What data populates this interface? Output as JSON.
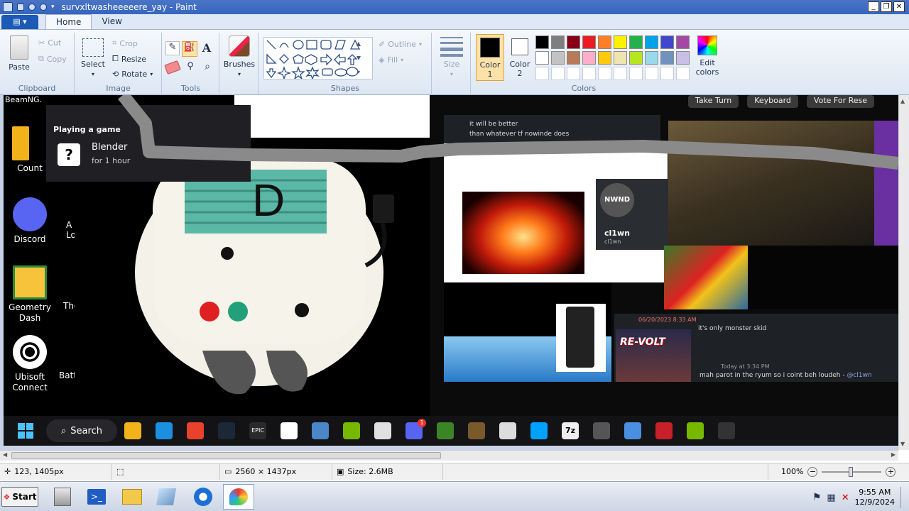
{
  "window": {
    "title": "survxltwasheeeeere_yay - Paint",
    "min": "_",
    "max": "❐",
    "close": "✕"
  },
  "ribbon_tabs": [
    {
      "label": "Home",
      "active": true
    },
    {
      "label": "View",
      "active": false
    }
  ],
  "clipboard": {
    "group": "Clipboard",
    "paste": "Paste",
    "cut": "Cut",
    "copy": "Copy"
  },
  "image": {
    "group": "Image",
    "select": "Select",
    "crop": "Crop",
    "resize": "Resize",
    "rotate": "Rotate"
  },
  "tools": {
    "group": "Tools",
    "pencil": "pencil-icon",
    "fill": "fill-bucket-icon",
    "text": "A",
    "eraser": "eraser-icon",
    "picker": "color-picker-icon",
    "magnifier": "magnifier-icon"
  },
  "brushes": {
    "label": "Brushes"
  },
  "shapes": {
    "group": "Shapes",
    "outline": "Outline",
    "fill": "Fill",
    "size": "Size"
  },
  "colors": {
    "group": "Colors",
    "color1_label": "Color",
    "color1_num": "1",
    "color2_label": "Color",
    "color2_num": "2",
    "edit_label1": "Edit",
    "edit_label2": "colors",
    "color1": "#000000",
    "color2": "#ffffff",
    "palette_row1": [
      "#000000",
      "#7f7f7f",
      "#880015",
      "#ed1c24",
      "#ff7f27",
      "#fff200",
      "#22b14c",
      "#00a2e8",
      "#3f48cc",
      "#a349a4"
    ],
    "palette_row2": [
      "#ffffff",
      "#c3c3c3",
      "#b97a57",
      "#ffaec9",
      "#ffc90e",
      "#efe4b0",
      "#b5e61d",
      "#99d9ea",
      "#7092be",
      "#c8bfe7"
    ]
  },
  "status": {
    "position": "123, 1405px",
    "dimensions": "2560 × 1437px",
    "size": "Size: 2.6MB",
    "zoom": "100%"
  },
  "taskbar": {
    "start": "Start",
    "time": "9:55 AM",
    "date": "12/9/2024"
  },
  "screenshot": {
    "desktop_icons": [
      {
        "label": "Count",
        "color": "#f2b21a"
      },
      {
        "label": "Discord",
        "color": "#5865f2"
      },
      {
        "label": "Geometry Dash",
        "color": "#f6c33a"
      },
      {
        "label": "Ubisoft Connect",
        "color": "#ffffff"
      }
    ],
    "desktop_icons_col2": [
      "A Lo",
      "Tho",
      "Battl"
    ],
    "beamng_label": "BeamNG.",
    "popup_header": "Playing a game",
    "popup_game": "Blender",
    "popup_time": "for 1 hour",
    "plush_letter": "D",
    "top_buttons": [
      "Take Turn",
      "Keyboard",
      "Vote For Rese"
    ],
    "chat_top": [
      "it will be better",
      "than whatever tf nowinde does"
    ],
    "nwnd_logo": "NWND",
    "user_name": "cl1wn",
    "user_sub": "cl1wn",
    "revolt": "RE-VOLT",
    "chat_only_monster": "it's only monster skid",
    "chat_parrot": "mah parot in the ryum so i coint beh loudeh",
    "mention": "@cl1wn",
    "chat_date": "06/20/2023 8:33 AM",
    "chat_today": "Today at 3:34 PM",
    "search": "Search",
    "w11_apps": [
      "file-explorer-icon",
      "edge-icon",
      "ea-icon",
      "steam-icon",
      "epic-games-icon",
      "ubisoft-icon",
      "virtualbox-icon",
      "nvidia-icon",
      "logitech-icon",
      "discord-icon",
      "minecraft-icon",
      "minecraft-grass-icon",
      "roblox-icon",
      "roblox-studio-icon",
      "7zip-icon",
      "game-controller-icon",
      "app-icon",
      "redline-icon",
      "nvidia-app-icon",
      "square-app-icon"
    ],
    "discord_badge": "1",
    "epic_label": "EPIC",
    "zip_label": "7z"
  }
}
